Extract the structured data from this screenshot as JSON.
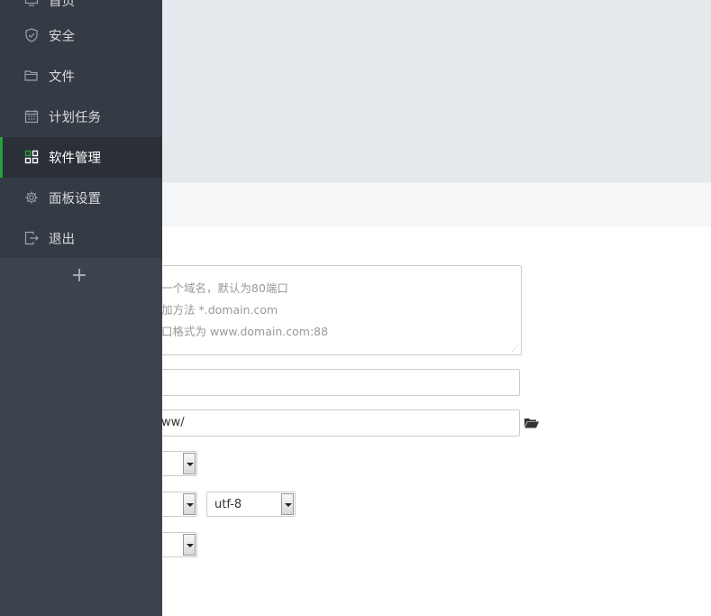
{
  "sidebar": {
    "items": [
      {
        "label": "首页",
        "icon": "monitor-icon",
        "active": false
      },
      {
        "label": "安全",
        "icon": "shield-icon",
        "active": false
      },
      {
        "label": "文件",
        "icon": "folder-icon",
        "active": false
      },
      {
        "label": "计划任务",
        "icon": "calendar-icon",
        "active": false
      },
      {
        "label": "软件管理",
        "icon": "grid-apps-icon",
        "active": true
      },
      {
        "label": "面板设置",
        "icon": "gear-icon",
        "active": false
      },
      {
        "label": "退出",
        "icon": "logout-icon",
        "active": false
      }
    ],
    "add_symbol": "+"
  },
  "form": {
    "domain_placeholder": {
      "line1": "一个域名，默认为80端口",
      "line2": "加方法 *.domain.com",
      "line3": "口格式为 www.domain.com:88"
    },
    "path_value": "ww/",
    "charset_value": "utf-8"
  },
  "colors": {
    "sidebar_bg": "#3c444d",
    "menu_bg": "#353b44",
    "active_bg": "#2b3038",
    "accent": "#20a53a"
  }
}
